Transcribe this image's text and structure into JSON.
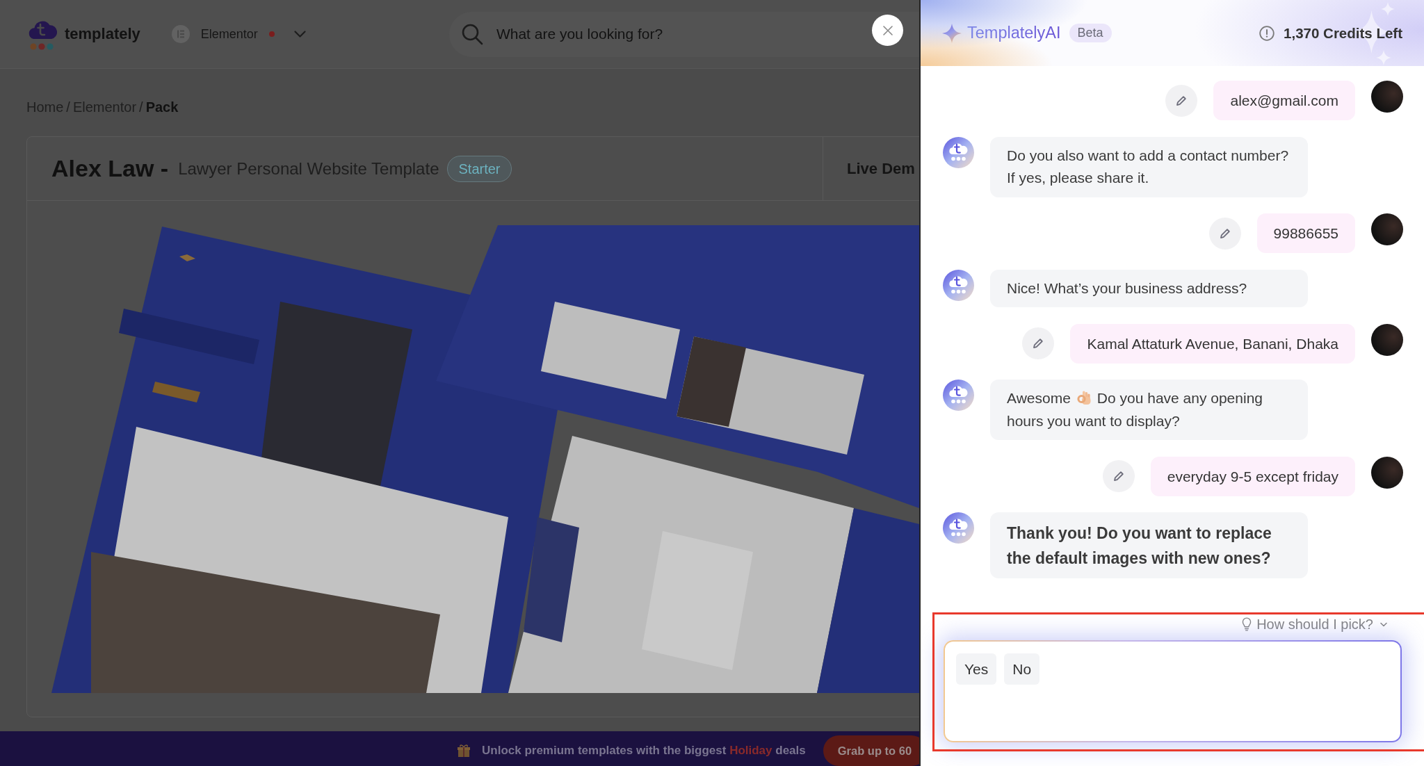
{
  "site": {
    "logo_text": "templately",
    "platform": "Elementor",
    "search": {
      "placeholder": "What are you looking for?"
    }
  },
  "breadcrumb": {
    "separator": "/",
    "items": [
      {
        "label": "Home",
        "current": false
      },
      {
        "label": "Elementor",
        "current": false
      },
      {
        "label": "Pack",
        "current": true
      }
    ]
  },
  "template": {
    "title": "Alex Law -",
    "subtitle": "Lawyer Personal Website Template",
    "badge": "Starter",
    "live_demo": "Live Dem"
  },
  "banner": {
    "text": "Unlock premium templates with the biggest **Holiday** deals",
    "button": "Grab up to 60"
  },
  "assistant": {
    "title": "TemplatelyAI",
    "badge": "Beta",
    "credits": "1,370 Credits Left",
    "messages": [
      {
        "kind": "user",
        "text": "alex@gmail.com"
      },
      {
        "kind": "bot",
        "parts": [
          {
            "kind": "text",
            "text": "Do you also want to add a contact number? If yes, please share it."
          }
        ]
      },
      {
        "kind": "user",
        "text": "99886655"
      },
      {
        "kind": "bot",
        "parts": [
          {
            "kind": "text",
            "text": "Nice! What’s your business address?"
          }
        ]
      },
      {
        "kind": "user",
        "text": "Kamal Attaturk Avenue, Banani, Dhaka"
      },
      {
        "kind": "bot",
        "parts": [
          {
            "kind": "text",
            "text": "Awesome"
          },
          {
            "kind": "emoji"
          },
          {
            "kind": "text",
            "text": "Do you have any opening hours you want to display?"
          }
        ]
      },
      {
        "kind": "user",
        "text": "everyday 9-5 except friday"
      },
      {
        "kind": "question",
        "parts": [
          {
            "kind": "text",
            "text": "Thank you! Do you want to replace the default images with new ones?"
          }
        ]
      }
    ],
    "hint": "How should I pick?",
    "options": [
      {
        "label": "Yes"
      },
      {
        "label": "No"
      }
    ]
  }
}
